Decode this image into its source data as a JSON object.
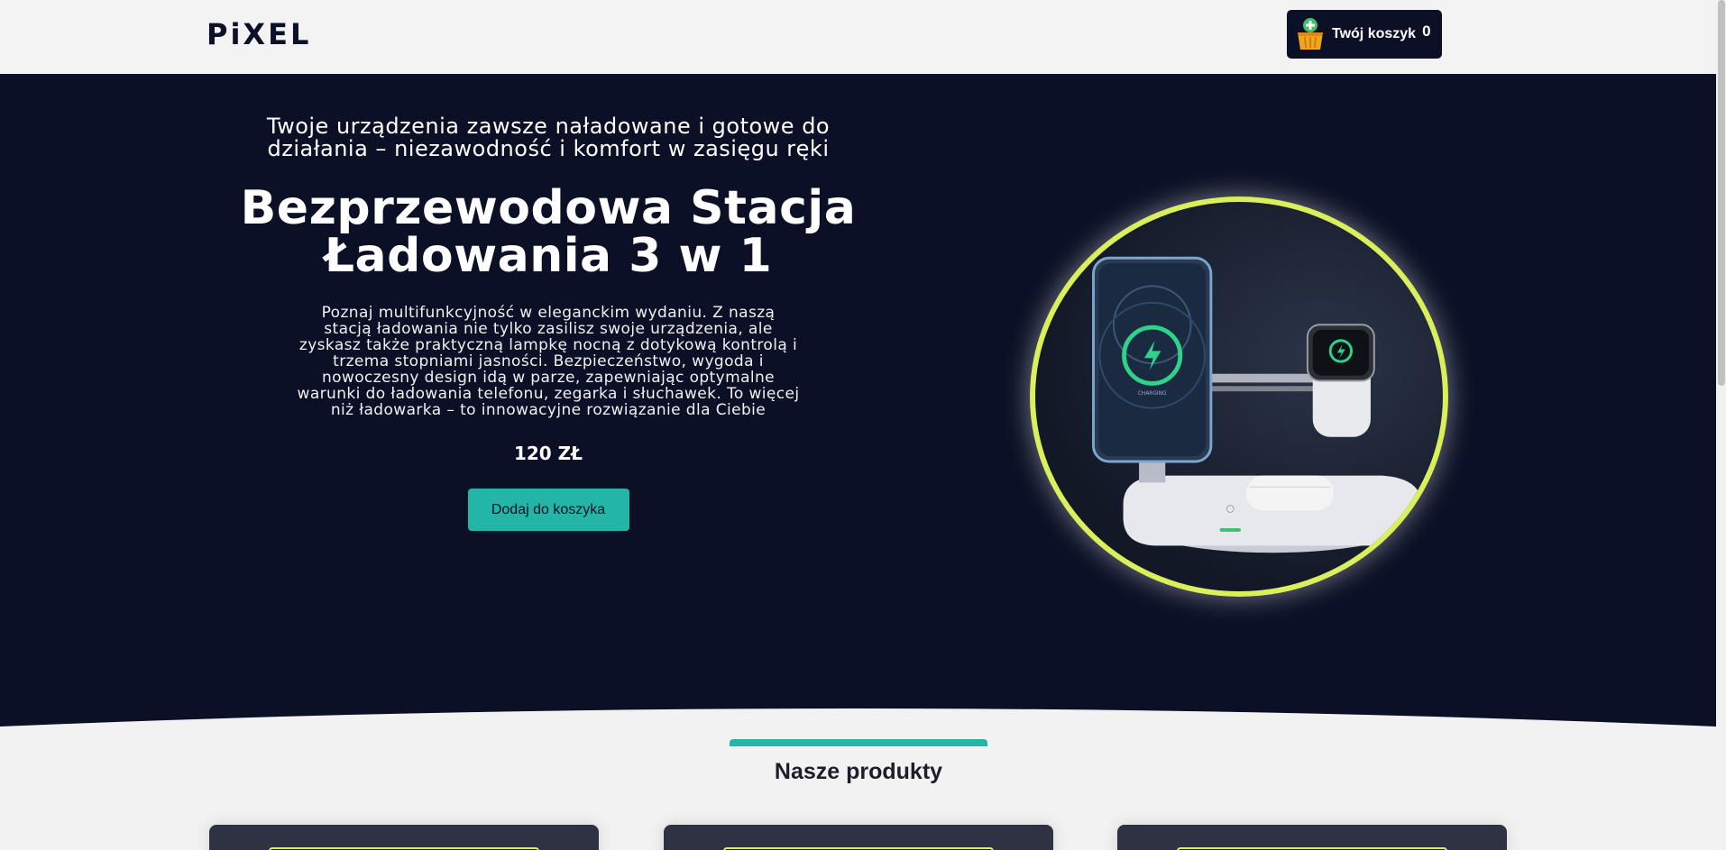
{
  "header": {
    "logo": "PiXEL",
    "cart": {
      "label": "Twój koszyk",
      "count": "0",
      "icon": "basket-add-icon"
    }
  },
  "hero": {
    "tagline": "Twoje urządzenia zawsze naładowane i gotowe do działania – niezawodność i komfort w zasięgu ręki",
    "title": "Bezprzewodowa Stacja Ładowania 3 w 1",
    "description": "Poznaj multifunkcyjność w eleganckim wydaniu. Z naszą stacją ładowania nie tylko zasilisz swoje urządzenia, ale zyskasz także praktyczną lampkę nocną z dotykową kontrolą i trzema stopniami jasności. Bezpieczeństwo, wygoda i nowoczesny design idą w parze, zapewniając optymalne warunki do ładowania telefonu, zegarka i słuchawek. To więcej niż ładowarka – to innowacyjne rozwiązanie dla Ciebie",
    "price": "120 ZŁ",
    "add_to_cart": "Dodaj do koszyka",
    "product_image": "wireless-charging-station-image"
  },
  "products_section": {
    "title": "Nasze produkty",
    "card_count": 3
  },
  "colors": {
    "navy": "#0b1026",
    "accent_teal": "#23b6a8",
    "accent_lime": "#d9f05c",
    "background": "#f2f2f2"
  }
}
